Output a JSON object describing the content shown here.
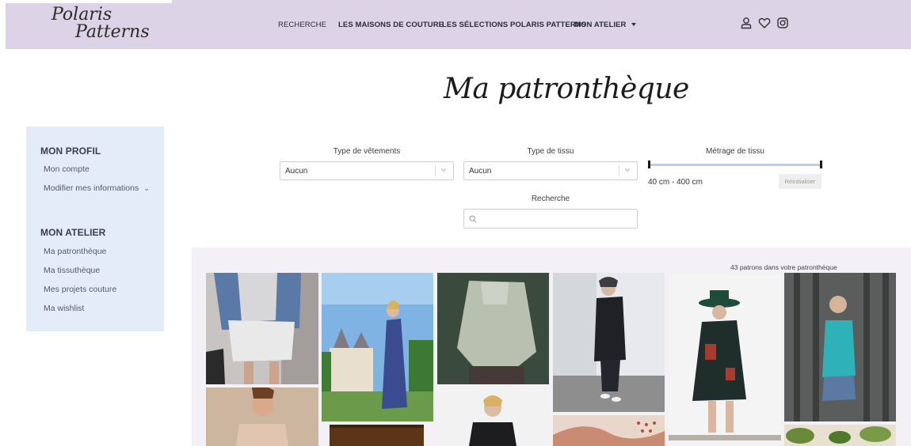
{
  "header": {
    "logo_line1": "Polaris",
    "logo_line2": "Patterns",
    "nav": [
      {
        "label": "RECHERCHE"
      },
      {
        "label": "LES MAISONS DE COUTURE"
      },
      {
        "label": "LES SÉLECTIONS POLARIS PATTERNS"
      },
      {
        "label": "MON ATELIER"
      }
    ],
    "icons": [
      "user-icon",
      "heart-icon",
      "instagram-icon"
    ]
  },
  "page_title": "Ma patronthèque",
  "sidebar": {
    "profile_heading": "MON PROFIL",
    "profile_items": [
      {
        "label": "Mon compte"
      },
      {
        "label": "Modifier mes informations"
      }
    ],
    "atelier_heading": "MON ATELIER",
    "atelier_items": [
      {
        "label": "Ma patronthèque"
      },
      {
        "label": "Ma tissuthèque"
      },
      {
        "label": "Mes projets couture"
      },
      {
        "label": "Ma wishlist"
      }
    ]
  },
  "filters": {
    "garment_label": "Type de vêtements",
    "garment_value": "Aucun",
    "fabric_label": "Type de tissu",
    "fabric_value": "Aucun",
    "yardage_label": "Métrage de tissu",
    "yardage_range": "40 cm - 400 cm",
    "yardage_min_cm": 40,
    "yardage_max_cm": 400,
    "reset_label": "Réinitialiser",
    "search_label": "Recherche",
    "search_value": ""
  },
  "results": {
    "count_text": "43 patrons dans votre patronthèque"
  },
  "colors": {
    "header_bg": "#dcd3e6",
    "sidebar_bg": "#e4ecf9",
    "results_bg": "#f3f0f6",
    "slider_track": "#b9ccea"
  }
}
